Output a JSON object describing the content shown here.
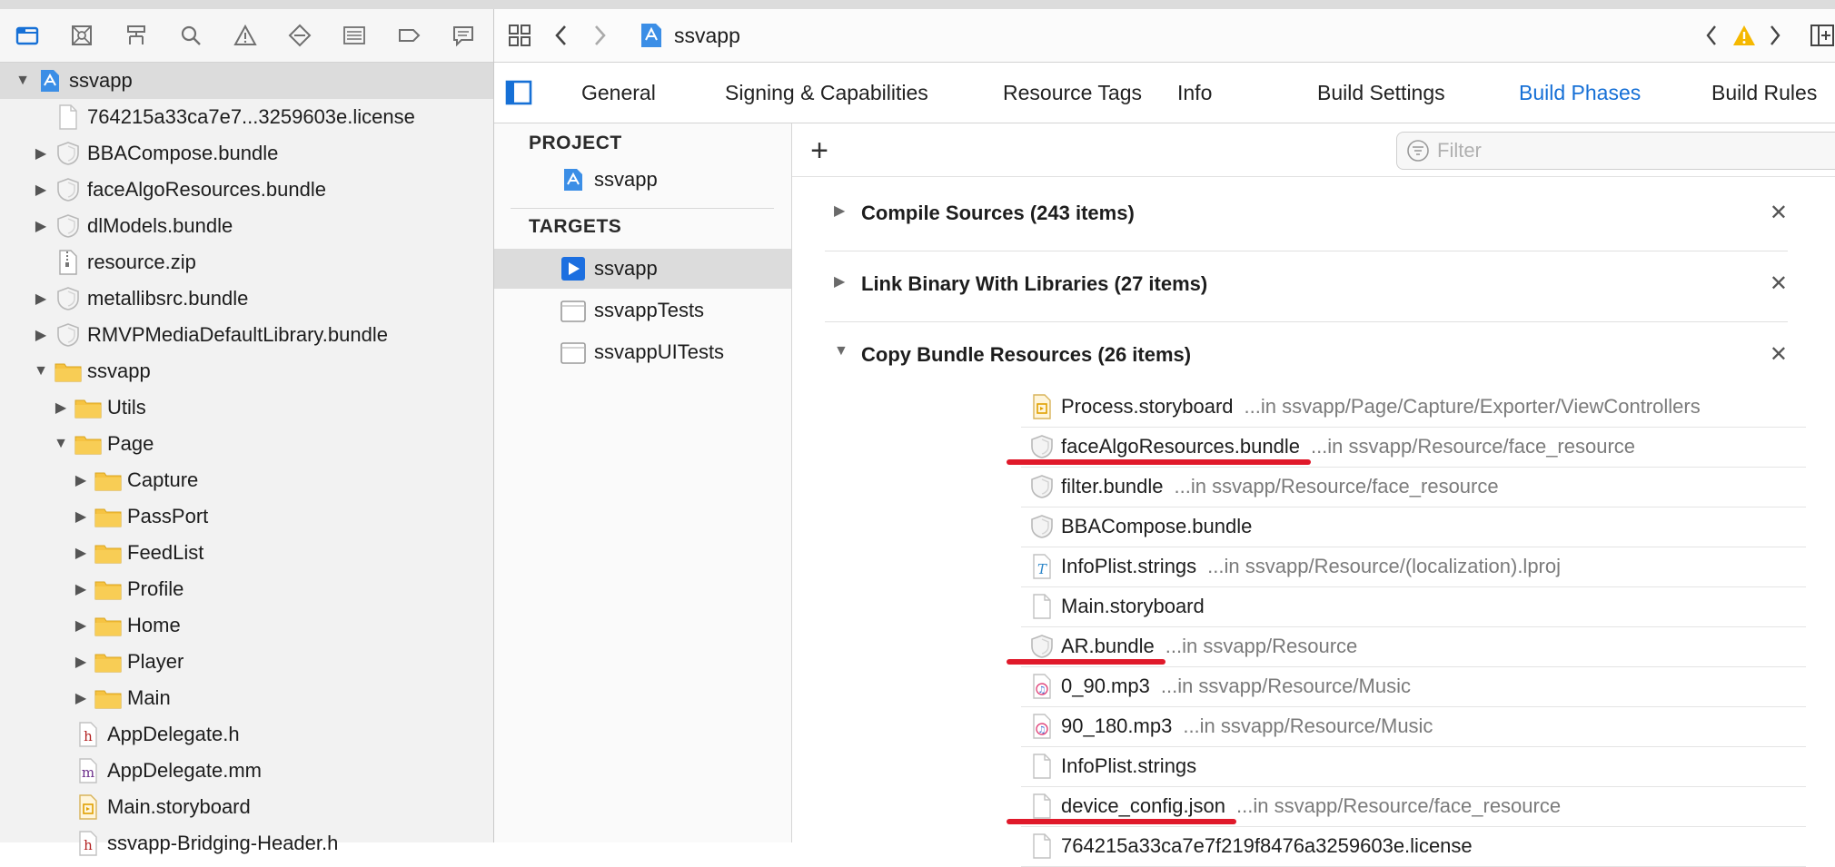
{
  "navigator": {
    "toolbar_icons": [
      "folder-icon",
      "source-control-icon",
      "hierarchy-icon",
      "search-icon",
      "warning-icon",
      "test-icon",
      "debug-icon",
      "breakpoint-icon",
      "report-icon"
    ],
    "items": [
      {
        "label": "ssvapp",
        "icon": "project-icon",
        "indent": 0,
        "disclosure": "open",
        "selected": true
      },
      {
        "label": "764215a33ca7e7...3259603e.license",
        "icon": "file-icon",
        "indent": 1,
        "disclosure": "none"
      },
      {
        "label": "BBACompose.bundle",
        "icon": "bundle-icon",
        "indent": 1,
        "disclosure": "closed"
      },
      {
        "label": "faceAlgoResources.bundle",
        "icon": "bundle-icon",
        "indent": 1,
        "disclosure": "closed"
      },
      {
        "label": "dlModels.bundle",
        "icon": "bundle-icon",
        "indent": 1,
        "disclosure": "closed"
      },
      {
        "label": "resource.zip",
        "icon": "zip-icon",
        "indent": 1,
        "disclosure": "none"
      },
      {
        "label": "metallibsrc.bundle",
        "icon": "bundle-icon",
        "indent": 1,
        "disclosure": "closed"
      },
      {
        "label": "RMVPMediaDefaultLibrary.bundle",
        "icon": "bundle-icon",
        "indent": 1,
        "disclosure": "closed"
      },
      {
        "label": "ssvapp",
        "icon": "folder-icon",
        "indent": 1,
        "disclosure": "open"
      },
      {
        "label": "Utils",
        "icon": "folder-icon",
        "indent": 2,
        "disclosure": "closed"
      },
      {
        "label": "Page",
        "icon": "folder-icon",
        "indent": 2,
        "disclosure": "open"
      },
      {
        "label": "Capture",
        "icon": "folder-icon",
        "indent": 3,
        "disclosure": "closed"
      },
      {
        "label": "PassPort",
        "icon": "folder-icon",
        "indent": 3,
        "disclosure": "closed"
      },
      {
        "label": "FeedList",
        "icon": "folder-icon",
        "indent": 3,
        "disclosure": "closed"
      },
      {
        "label": "Profile",
        "icon": "folder-icon",
        "indent": 3,
        "disclosure": "closed"
      },
      {
        "label": "Home",
        "icon": "folder-icon",
        "indent": 3,
        "disclosure": "closed"
      },
      {
        "label": "Player",
        "icon": "folder-icon",
        "indent": 3,
        "disclosure": "closed"
      },
      {
        "label": "Main",
        "icon": "folder-icon",
        "indent": 3,
        "disclosure": "closed"
      },
      {
        "label": "AppDelegate.h",
        "icon": "header-file-icon",
        "indent": 2,
        "disclosure": "none"
      },
      {
        "label": "AppDelegate.mm",
        "icon": "impl-file-icon",
        "indent": 2,
        "disclosure": "none"
      },
      {
        "label": "Main.storyboard",
        "icon": "storyboard-icon",
        "indent": 2,
        "disclosure": "none"
      },
      {
        "label": "ssvapp-Bridging-Header.h",
        "icon": "header-file-icon",
        "indent": 2,
        "disclosure": "none"
      }
    ]
  },
  "editor": {
    "breadcrumb": {
      "project": "ssvapp"
    },
    "tabs": [
      "General",
      "Signing & Capabilities",
      "Resource Tags",
      "Info",
      "Build Settings",
      "Build Phases",
      "Build Rules"
    ],
    "active_tab": "Build Phases",
    "project_header": "PROJECT",
    "project_item": "ssvapp",
    "targets_header": "TARGETS",
    "targets": [
      {
        "label": "ssvapp",
        "icon": "app-target-icon",
        "selected": true
      },
      {
        "label": "ssvappTests",
        "icon": "test-target-icon",
        "selected": false
      },
      {
        "label": "ssvappUITests",
        "icon": "test-target-icon",
        "selected": false
      }
    ],
    "filter_placeholder": "Filter",
    "phases": [
      {
        "title": "Compile Sources (243 items)",
        "expanded": false
      },
      {
        "title": "Link Binary With Libraries (27 items)",
        "expanded": false
      },
      {
        "title": "Copy Bundle Resources (26 items)",
        "expanded": true
      }
    ],
    "resources": [
      {
        "name": "Process.storyboard",
        "path": "...in ssvapp/Page/Capture/Exporter/ViewControllers",
        "icon": "storyboard-icon",
        "underlined": false
      },
      {
        "name": "faceAlgoResources.bundle",
        "path": "...in ssvapp/Resource/face_resource",
        "icon": "bundle-icon",
        "underlined": true
      },
      {
        "name": "filter.bundle",
        "path": "...in ssvapp/Resource/face_resource",
        "icon": "bundle-icon",
        "underlined": false
      },
      {
        "name": "BBACompose.bundle",
        "path": "",
        "icon": "bundle-icon",
        "underlined": false
      },
      {
        "name": "InfoPlist.strings",
        "path": "...in ssvapp/Resource/(localization).lproj",
        "icon": "strings-icon",
        "underlined": false
      },
      {
        "name": "Main.storyboard",
        "path": "",
        "icon": "blank-file-icon",
        "underlined": false
      },
      {
        "name": "AR.bundle",
        "path": "...in ssvapp/Resource",
        "icon": "bundle-icon",
        "underlined": true
      },
      {
        "name": "0_90.mp3",
        "path": "...in ssvapp/Resource/Music",
        "icon": "audio-file-icon",
        "underlined": false
      },
      {
        "name": "90_180.mp3",
        "path": "...in ssvapp/Resource/Music",
        "icon": "audio-file-icon",
        "underlined": false
      },
      {
        "name": "InfoPlist.strings",
        "path": "",
        "icon": "blank-file-icon",
        "underlined": false
      },
      {
        "name": "device_config.json",
        "path": "...in ssvapp/Resource/face_resource",
        "icon": "file-icon",
        "underlined": true
      },
      {
        "name": "764215a33ca7e7f219f8476a3259603e.license",
        "path": "",
        "icon": "file-icon",
        "underlined": false
      }
    ]
  },
  "colors": {
    "accent": "#1670d6",
    "annotation_red": "#e0192a",
    "folder_yellow": "#f6c342"
  }
}
